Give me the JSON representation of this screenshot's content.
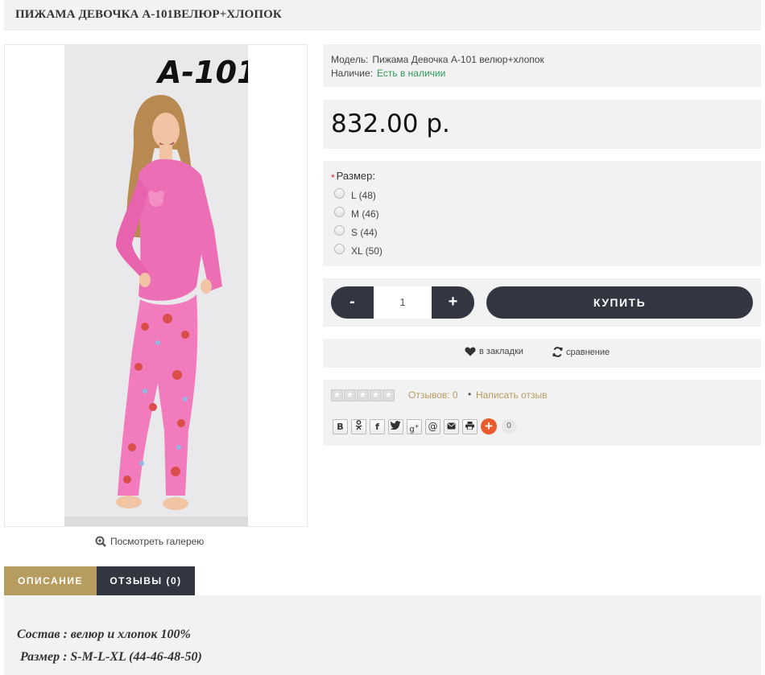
{
  "product": {
    "title": "ПИЖАМА ДЕВОЧКА А-101ВЕЛЮР+ХЛОПОК",
    "image_caption": "A-101",
    "gallery_link": "Посмотреть галерею",
    "model_label": "Модель:",
    "model_value": "Пижама Девочка А-101 велюр+хлопок",
    "stock_label": "Наличие:",
    "stock_value": "Есть в наличии",
    "price": "832.00 р.",
    "option_required_mark": "*",
    "option_label": "Размер:",
    "sizes": [
      "L (48)",
      "M (46)",
      "S (44)",
      "XL (50)"
    ],
    "quantity": "1",
    "minus_label": "-",
    "plus_label": "+",
    "buy_label": "КУПИТЬ",
    "wishlist_label": "в закладки",
    "compare_label": "сравнение",
    "reviews_count_label": "Отзывов: 0",
    "reviews_separator": "•",
    "write_review_label": "Написать отзыв",
    "share_buttons": [
      "В",
      "ok",
      "f",
      "tw",
      "g+",
      "@",
      "mail",
      "print"
    ],
    "share_count": "0"
  },
  "tabs": {
    "description": "ОПИСАНИЕ",
    "reviews": "ОТЗЫВЫ (0)"
  },
  "description": {
    "line1": "Состав : велюр и хлопок 100%",
    "line2": "Размер : S-M-L-XL (44-46-48-50)"
  },
  "colors": {
    "accent": "#b79c60",
    "dark": "#313640",
    "in_stock": "#2e9a57",
    "panel_bg": "#f2f2f2"
  }
}
